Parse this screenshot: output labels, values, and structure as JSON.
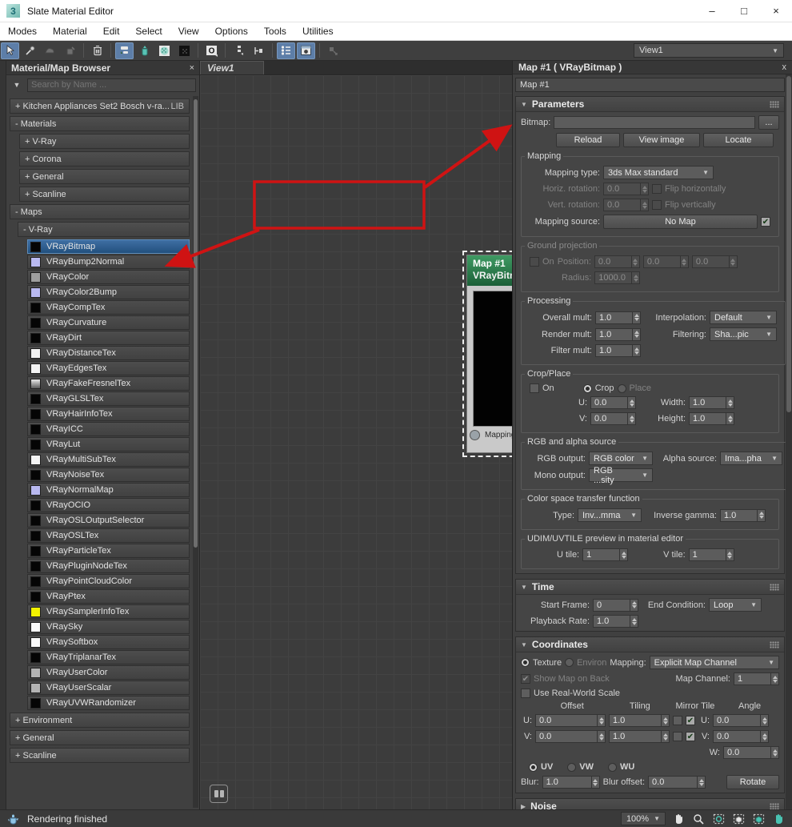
{
  "window": {
    "icon": "3",
    "title": "Slate Material Editor",
    "minimize": "–",
    "maximize": "□",
    "close": "×"
  },
  "menu": {
    "items": [
      "Modes",
      "Material",
      "Edit",
      "Select",
      "View",
      "Options",
      "Tools",
      "Utilities"
    ]
  },
  "toolbar": {
    "view_selector": "View1",
    "icons": [
      "select-tool",
      "pick-material-from-object",
      "assign-material-to-selection",
      "put-material-to-scene",
      "delete-selected",
      "move-children",
      "hide-unused-nodeslots",
      "show-shaded-material-in-viewport",
      "show-background",
      "material-id-channel",
      "layout-all-vertical",
      "layout-children",
      "material-map-browser-toggle",
      "parameter-editor-toggle",
      "select-by-material"
    ]
  },
  "browser": {
    "title": "Material/Map Browser",
    "close": "×",
    "search_placeholder": "Search by Name ...",
    "library_row": {
      "label": "+ Kitchen Appliances Set2 Bosch v-ra...",
      "badge": "LIB"
    },
    "materials_header": "- Materials",
    "materials_groups": [
      "+ V-Ray",
      "+ Corona",
      "+ General",
      "+ Scanline"
    ],
    "maps_header": "- Maps",
    "maps_vray_header": "- V-Ray",
    "vray_maps": [
      {
        "label": "VRayBitmap",
        "swatch": "#050505",
        "selected": true
      },
      {
        "label": "VRayBump2Normal",
        "swatch": "#b9b9f0"
      },
      {
        "label": "VRayColor",
        "swatch": "#9e9e9e"
      },
      {
        "label": "VRayColor2Bump",
        "swatch": "#b9b9f0"
      },
      {
        "label": "VRayCompTex",
        "swatch": "#050505"
      },
      {
        "label": "VRayCurvature",
        "swatch": "#050505"
      },
      {
        "label": "VRayDirt",
        "swatch": "#050505"
      },
      {
        "label": "VRayDistanceTex",
        "swatch": "#f2f2f2"
      },
      {
        "label": "VRayEdgesTex",
        "swatch": "#f2f2f2"
      },
      {
        "label": "VRayFakeFresnelTex",
        "swatch": "linear-gradient(180deg,#e9e9e9,#5a5a5a)"
      },
      {
        "label": "VRayGLSLTex",
        "swatch": "#050505"
      },
      {
        "label": "VRayHairInfoTex",
        "swatch": "#050505"
      },
      {
        "label": "VRayICC",
        "swatch": "#050505"
      },
      {
        "label": "VRayLut",
        "swatch": "#050505"
      },
      {
        "label": "VRayMultiSubTex",
        "swatch": "#f5f5f5"
      },
      {
        "label": "VRayNoiseTex",
        "swatch": "#050505"
      },
      {
        "label": "VRayNormalMap",
        "swatch": "#b9b9f0"
      },
      {
        "label": "VRayOCIO",
        "swatch": "#050505"
      },
      {
        "label": "VRayOSLOutputSelector",
        "swatch": "#050505"
      },
      {
        "label": "VRayOSLTex",
        "swatch": "#050505"
      },
      {
        "label": "VRayParticleTex",
        "swatch": "#050505"
      },
      {
        "label": "VRayPluginNodeTex",
        "swatch": "#050505"
      },
      {
        "label": "VRayPointCloudColor",
        "swatch": "#050505"
      },
      {
        "label": "VRayPtex",
        "swatch": "#050505"
      },
      {
        "label": "VRaySamplerInfoTex",
        "swatch": "#f2f200"
      },
      {
        "label": "VRaySky",
        "swatch": "#fafafa"
      },
      {
        "label": "VRaySoftbox",
        "swatch": "#fafafa"
      },
      {
        "label": "VRayTriplanarTex",
        "swatch": "#050505"
      },
      {
        "label": "VRayUserColor",
        "swatch": "#b3b3b3"
      },
      {
        "label": "VRayUserScalar",
        "swatch": "#b3b3b3"
      },
      {
        "label": "VRayUVWRandomizer",
        "swatch": "#050505"
      }
    ],
    "bottom_groups": [
      "+ Environment",
      "+ General",
      "+ Scanline"
    ]
  },
  "view": {
    "tab": "View1",
    "node": {
      "title": "Map #1",
      "subtitle": "VRayBitmap",
      "collapse": "−",
      "input_slot": "Mapping source"
    }
  },
  "inspector": {
    "header": "Map #1  ( VRayBitmap )",
    "close": "x",
    "name_value": "Map #1",
    "parameters": {
      "title": "Parameters",
      "bitmap_label": "Bitmap:",
      "bitmap_value": "",
      "browse": "...",
      "reload": "Reload",
      "view_image": "View image",
      "locate": "Locate",
      "mapping": {
        "legend": "Mapping",
        "type_label": "Mapping type:",
        "type_value": "3ds Max standard",
        "horiz_label": "Horiz. rotation:",
        "horiz_value": "0.0",
        "flip_h": "Flip horizontally",
        "vert_label": "Vert. rotation:",
        "vert_value": "0.0",
        "flip_v": "Flip vertically",
        "source_label": "Mapping source:",
        "source_value": "No Map"
      },
      "ground": {
        "legend": "Ground projection",
        "on": "On",
        "position_label": "Position:",
        "pos1": "0.0",
        "pos2": "0.0",
        "pos3": "0.0",
        "radius_label": "Radius:",
        "radius": "1000.0"
      },
      "processing": {
        "legend": "Processing",
        "overall_label": "Overall mult:",
        "overall": "1.0",
        "interp_label": "Interpolation:",
        "interp": "Default",
        "render_label": "Render mult:",
        "render": "1.0",
        "filtering_label": "Filtering:",
        "filtering": "Sha...pic",
        "filter_label": "Filter mult:",
        "filter": "1.0"
      },
      "crop": {
        "legend": "Crop/Place",
        "on": "On",
        "crop": "Crop",
        "place": "Place",
        "u_label": "U:",
        "u": "0.0",
        "v_label": "V:",
        "v": "0.0",
        "width_label": "Width:",
        "width": "1.0",
        "height_label": "Height:",
        "height": "1.0"
      },
      "rgb": {
        "legend": "RGB and alpha source",
        "rgb_label": "RGB output:",
        "rgb": "RGB color",
        "alpha_label": "Alpha source:",
        "alpha": "Ima...pha",
        "mono_label": "Mono output:",
        "mono": "RGB ...sity"
      },
      "colorspace": {
        "legend": "Color space transfer function",
        "type_label": "Type:",
        "type": "Inv...mma",
        "gamma_label": "Inverse gamma:",
        "gamma": "1.0"
      },
      "udim": {
        "legend": "UDIM/UVTILE preview in material editor",
        "u_label": "U tile:",
        "u": "1",
        "v_label": "V tile:",
        "v": "1"
      }
    },
    "time": {
      "title": "Time",
      "start_label": "Start Frame:",
      "start": "0",
      "end_label": "End Condition:",
      "end": "Loop",
      "rate_label": "Playback Rate:",
      "rate": "1.0"
    },
    "coordinates": {
      "title": "Coordinates",
      "texture": "Texture",
      "environ": "Environ",
      "mapping_label": "Mapping:",
      "mapping": "Explicit Map Channel",
      "show_back": "Show Map on Back",
      "map_channel_label": "Map Channel:",
      "map_channel": "1",
      "real_world": "Use Real-World Scale",
      "col_offset": "Offset",
      "col_tiling": "Tiling",
      "col_mirror": "Mirror Tile",
      "col_angle": "Angle",
      "u_label": "U:",
      "v_label": "V:",
      "w_label": "W:",
      "u_offset": "0.0",
      "u_tiling": "1.0",
      "u_angle": "0.0",
      "v_offset": "0.0",
      "v_tiling": "1.0",
      "v_angle": "0.0",
      "w_angle": "0.0",
      "uv": "UV",
      "vw": "VW",
      "wu": "WU",
      "blur_label": "Blur:",
      "blur": "1.0",
      "blur_offset_label": "Blur offset:",
      "blur_offset": "0.0",
      "rotate": "Rotate"
    },
    "noise": {
      "title": "Noise"
    }
  },
  "statusbar": {
    "message": "Rendering finished",
    "zoom": "100%",
    "icons": [
      "render-progress-teapot",
      "pan-tool",
      "zoom-tool",
      "zoom-region",
      "zoom-extents",
      "zoom-extents-selected",
      "pan-to-selected"
    ]
  },
  "annotation_color": "#cf1313"
}
